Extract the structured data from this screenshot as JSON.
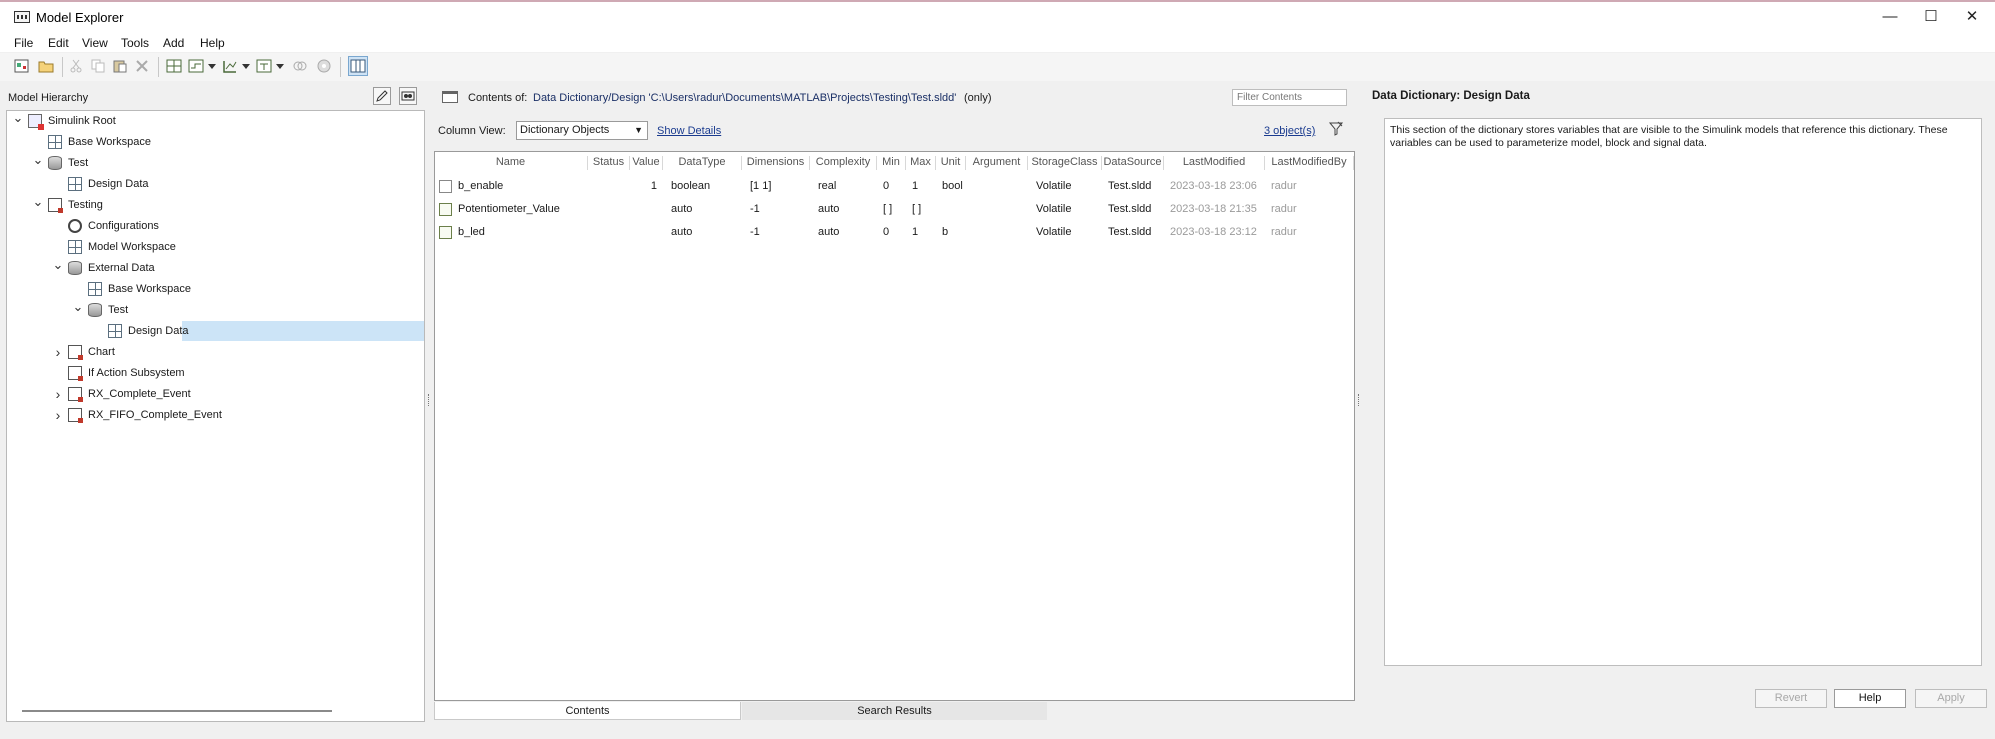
{
  "window": {
    "title": "Model Explorer",
    "minimize": "—",
    "maximize": "☐",
    "close": "✕"
  },
  "menu": [
    "File",
    "Edit",
    "View",
    "Tools",
    "Add",
    "Help"
  ],
  "hierarchy": {
    "header": "Model Hierarchy",
    "items": [
      {
        "label": "Simulink Root",
        "icon": "simulink-root-icon",
        "toggle": "expanded"
      },
      {
        "label": "Base Workspace",
        "icon": "workspace-icon",
        "toggle": ""
      },
      {
        "label": "Test",
        "icon": "database-icon",
        "toggle": "expanded"
      },
      {
        "label": "Design Data",
        "icon": "design-data-icon",
        "toggle": ""
      },
      {
        "label": "Testing",
        "icon": "model-icon",
        "toggle": "expanded"
      },
      {
        "label": "Configurations",
        "icon": "configuration-gear-icon",
        "toggle": ""
      },
      {
        "label": "Model Workspace",
        "icon": "workspace-icon",
        "toggle": ""
      },
      {
        "label": "External Data",
        "icon": "database-icon",
        "toggle": "expanded"
      },
      {
        "label": "Base Workspace",
        "icon": "workspace-icon",
        "toggle": ""
      },
      {
        "label": "Test",
        "icon": "database-icon",
        "toggle": "expanded"
      },
      {
        "label": "Design Data",
        "icon": "design-data-icon",
        "toggle": "",
        "selected": true
      },
      {
        "label": "Chart",
        "icon": "chart-icon",
        "toggle": "collapsed"
      },
      {
        "label": "If Action Subsystem",
        "icon": "subsystem-icon",
        "toggle": ""
      },
      {
        "label": "RX_Complete_Event",
        "icon": "subsystem-icon",
        "toggle": "collapsed"
      },
      {
        "label": "RX_FIFO_Complete_Event",
        "icon": "subsystem-icon",
        "toggle": "collapsed"
      }
    ]
  },
  "contents": {
    "label": "Contents of:",
    "path": "Data Dictionary/Design  'C:\\Users\\radur\\Documents\\MATLAB\\Projects\\Testing\\Test.sldd'",
    "scope": "(only)",
    "filter_placeholder": "Filter Contents",
    "column_view_label": "Column View:",
    "column_view_value": "Dictionary Objects",
    "show_details": "Show Details",
    "object_count": "3 object(s)"
  },
  "table": {
    "columns": [
      "Name",
      "Status",
      "Value",
      "DataType",
      "Dimensions",
      "Complexity",
      "Min",
      "Max",
      "Unit",
      "Argument",
      "StorageClass",
      "DataSource",
      "LastModified",
      "LastModifiedBy"
    ],
    "rows": [
      {
        "icon": "boolean-param-icon",
        "Name": "b_enable",
        "Status": "",
        "Value": "1",
        "DataType": "boolean",
        "Dimensions": "[1 1]",
        "Complexity": "real",
        "Min": "0",
        "Max": "1",
        "Unit": "bool",
        "Argument": "",
        "StorageClass": "Volatile",
        "DataSource": "Test.sldd",
        "LastModified": "2023-03-18 23:06",
        "LastModifiedBy": "radur"
      },
      {
        "icon": "signal-icon",
        "Name": "Potentiometer_Value",
        "Status": "",
        "Value": "",
        "DataType": "auto",
        "Dimensions": "-1",
        "Complexity": "auto",
        "Min": "[ ]",
        "Max": "[ ]",
        "Unit": "",
        "Argument": "",
        "StorageClass": "Volatile",
        "DataSource": "Test.sldd",
        "LastModified": "2023-03-18 21:35",
        "LastModifiedBy": "radur"
      },
      {
        "icon": "signal-icon",
        "Name": "b_led",
        "Status": "",
        "Value": "",
        "DataType": "auto",
        "Dimensions": "-1",
        "Complexity": "auto",
        "Min": "0",
        "Max": "1",
        "Unit": "b",
        "Argument": "",
        "StorageClass": "Volatile",
        "DataSource": "Test.sldd",
        "LastModified": "2023-03-18 23:12",
        "LastModifiedBy": "radur"
      }
    ]
  },
  "tabs": [
    "Contents",
    "Search Results"
  ],
  "details": {
    "title": "Data Dictionary: Design Data",
    "description": "This section of the dictionary stores variables that are visible to the Simulink models that reference this dictionary. These variables can be used to parameterize model, block and signal data.",
    "buttons": {
      "revert": "Revert",
      "help": "Help",
      "apply": "Apply"
    }
  }
}
